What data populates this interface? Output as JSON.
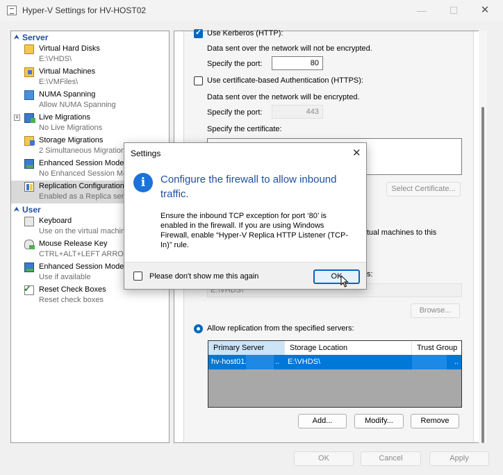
{
  "window": {
    "title": "Hyper-V Settings for HV-HOST02",
    "minimize": "—",
    "maximize": "☐",
    "close": "✕"
  },
  "sidebar": {
    "server_header": "Server",
    "user_header": "User",
    "server_items": [
      {
        "name": "Virtual Hard Disks",
        "sub": "E:\\VHDS\\",
        "icon": "folder-disk-icon"
      },
      {
        "name": "Virtual Machines",
        "sub": "E:\\VMFiles\\",
        "icon": "folder-vm-icon"
      },
      {
        "name": "NUMA Spanning",
        "sub": "Allow NUMA Spanning",
        "icon": "numa-icon"
      },
      {
        "name": "Live Migrations",
        "sub": "No Live Migrations",
        "icon": "live-migration-icon"
      },
      {
        "name": "Storage Migrations",
        "sub": "2 Simultaneous Migrations",
        "icon": "storage-migration-icon"
      },
      {
        "name": "Enhanced Session Mode Policy",
        "sub": "No Enhanced Session Mode",
        "icon": "enhanced-session-icon"
      },
      {
        "name": "Replication Configuration",
        "sub": "Enabled as a Replica server",
        "icon": "replication-icon"
      }
    ],
    "user_items": [
      {
        "name": "Keyboard",
        "sub": "Use on the virtual machine",
        "icon": "keyboard-icon"
      },
      {
        "name": "Mouse Release Key",
        "sub": "CTRL+ALT+LEFT ARROW",
        "icon": "mouse-icon"
      },
      {
        "name": "Enhanced Session Mode",
        "sub": "Use if available",
        "icon": "enhanced-session-icon"
      },
      {
        "name": "Reset Check Boxes",
        "sub": "Reset check boxes",
        "icon": "reset-checkbox-icon"
      }
    ]
  },
  "replication": {
    "kerberos_label": "Use Kerberos (HTTP):",
    "kerberos_note": "Data sent over the network will not be encrypted.",
    "port_label": "Specify the port:",
    "kerberos_port": "80",
    "cert_label": "Use certificate-based Authentication (HTTPS):",
    "cert_note": "Data sent over the network will be encrypted.",
    "cert_port": "443",
    "cert_spec_label": "Specify the certificate:",
    "select_cert_button": "Select Certificate...",
    "allow_any_tail": "tual machines to this",
    "location_tail": "s:",
    "storage_path": "E:\\VHDS\\",
    "browse_button": "Browse...",
    "allow_specified_label": "Allow replication from the specified servers:",
    "grid_headers": [
      "Primary Server",
      "Storage Location",
      "Trust Group"
    ],
    "grid_row": {
      "server": "hv-host01.",
      "server_tail": "..",
      "location": "E:\\VHDS\\",
      "trust_tail": ".."
    },
    "add_button": "Add...",
    "modify_button": "Modify...",
    "remove_button": "Remove"
  },
  "footer": {
    "ok": "OK",
    "cancel": "Cancel",
    "apply": "Apply"
  },
  "dialog": {
    "title": "Settings",
    "close": "✕",
    "icon": "info-icon",
    "headline": "Configure the firewall to allow inbound traffic.",
    "body": "Ensure the inbound TCP exception for port ‘80’ is enabled in the firewall. If you are using Windows Firewall, enable “Hyper-V Replica HTTP Listener (TCP-In)” rule.",
    "dont_show_label": "Please don't show me this again",
    "ok_button": "OK"
  }
}
